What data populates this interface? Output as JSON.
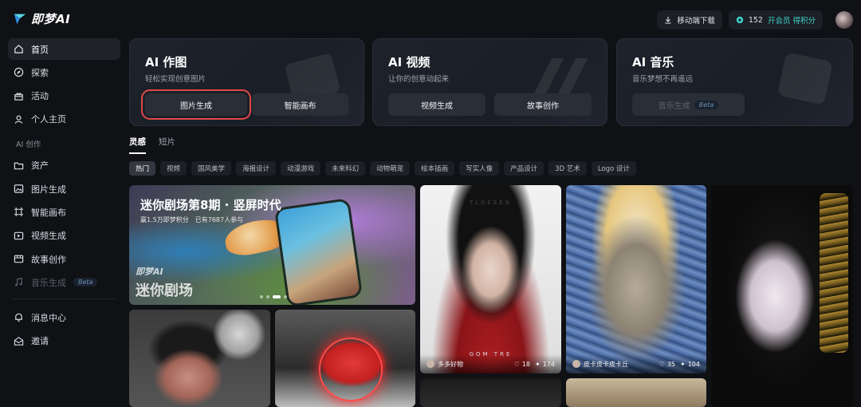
{
  "app": {
    "name": "即梦AI"
  },
  "topbar": {
    "download_label": "移动端下载",
    "credits": "152",
    "vip_label": "开会员 得积分"
  },
  "sidebar": {
    "items": [
      {
        "label": "首页",
        "icon": "home-icon",
        "active": true
      },
      {
        "label": "探索",
        "icon": "compass-icon"
      },
      {
        "label": "活动",
        "icon": "gift-icon"
      },
      {
        "label": "个人主页",
        "icon": "user-icon"
      }
    ],
    "section_label": "AI 创作",
    "create_items": [
      {
        "label": "资产",
        "icon": "folder-icon"
      },
      {
        "label": "图片生成",
        "icon": "image-gen-icon"
      },
      {
        "label": "智能画布",
        "icon": "canvas-icon"
      },
      {
        "label": "视频生成",
        "icon": "video-icon"
      },
      {
        "label": "故事创作",
        "icon": "story-icon"
      },
      {
        "label": "音乐生成",
        "icon": "music-icon",
        "disabled": true,
        "badge": "Beta"
      }
    ],
    "bottom_items": [
      {
        "label": "消息中心",
        "icon": "bell-icon"
      },
      {
        "label": "邀请",
        "icon": "invite-icon"
      }
    ]
  },
  "cards": [
    {
      "title": "AI 作图",
      "subtitle": "轻松实现创意图片",
      "buttons": [
        "图片生成",
        "智能画布"
      ]
    },
    {
      "title": "AI 视频",
      "subtitle": "让你的创意动起来",
      "buttons": [
        "视频生成",
        "故事创作"
      ]
    },
    {
      "title": "AI 音乐",
      "subtitle": "音乐梦想不再遥远",
      "buttons": [
        "音乐生成"
      ],
      "badge": "Beta"
    }
  ],
  "tabs": [
    "灵感",
    "短片"
  ],
  "chips": [
    "热门",
    "视频",
    "国风美学",
    "海报设计",
    "动漫游戏",
    "未来科幻",
    "动物萌宠",
    "绘本插画",
    "写实人像",
    "产品设计",
    "3D 艺术",
    "Logo 设计"
  ],
  "banner": {
    "title": "迷你剧场第8期 · 竖屏时代",
    "reward": "赢1.5万即梦积分",
    "participants": "已有7687人参与",
    "logo_line1": "即梦AI",
    "logo_line2": "迷你剧场"
  },
  "gallery": [
    {
      "author": "多多好物",
      "likes": "18",
      "remixes": "174",
      "overlay_top": "TLOEEEN",
      "overlay_bottom": "GOM TRE"
    },
    {
      "author": "皮卡皮卡皮卡丘",
      "likes": "35",
      "remixes": "104"
    }
  ],
  "colors": {
    "accent": "#3fd0c9",
    "highlight": "#e04848",
    "background": "#0f1115"
  }
}
